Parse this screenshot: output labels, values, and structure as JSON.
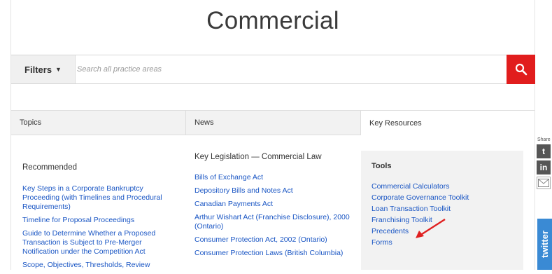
{
  "title": "Commercial",
  "search": {
    "filters_label": "Filters",
    "placeholder": "Search all practice areas"
  },
  "tabs": [
    {
      "label": "Topics"
    },
    {
      "label": "News"
    },
    {
      "label": "Key Resources"
    }
  ],
  "topics": {
    "heading": "Recommended",
    "links": [
      "Key Steps in a Corporate Bankruptcy Proceeding (with Timelines and Procedural Requirements)",
      "Timeline for Proposal Proceedings",
      "Guide to Determine Whether a Proposed Transaction is Subject to Pre-Merger Notification under the Competition Act",
      "Scope, Objectives, Thresholds, Review"
    ]
  },
  "news": {
    "heading": "Key Legislation — Commercial Law",
    "links": [
      "Bills of Exchange Act",
      "Depository Bills and Notes Act",
      "Canadian Payments Act",
      "Arthur Wishart Act (Franchise Disclosure), 2000 (Ontario)",
      "Consumer Protection Act, 2002 (Ontario)",
      "Consumer Protection Laws (British Columbia)"
    ]
  },
  "key_resources": {
    "heading": "Tools",
    "links": [
      "Commercial Calculators",
      "Corporate Governance Toolkit",
      "Loan Transaction Toolkit",
      "Franchising Toolkit",
      "Precedents",
      "Forms"
    ]
  },
  "share": {
    "label": "Share",
    "twitter_label": "twitter"
  },
  "colors": {
    "accent": "#e11d1d",
    "link": "#1a56c4",
    "twitter": "#3a8ad4"
  }
}
